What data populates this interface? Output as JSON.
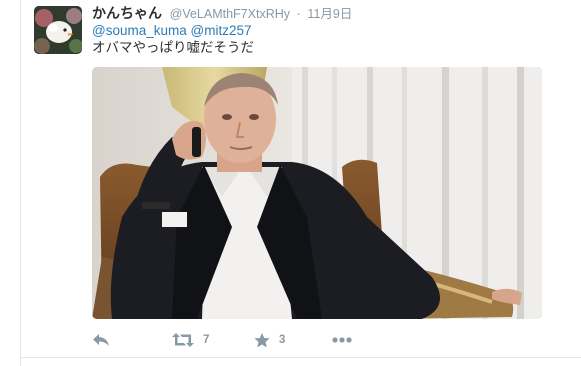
{
  "tweet": {
    "display_name": "かんちゃん",
    "screen_name": "@VeLAMthF7XtxRHy",
    "separator": "·",
    "timestamp": "11月9日",
    "mentions": [
      "@souma_kuma",
      "@mitz257"
    ],
    "text": "オバマやっぱり嘘だそうだ"
  },
  "actions": {
    "reply_icon": "reply-icon",
    "retweet_icon": "retweet-icon",
    "retweet_count": "7",
    "favorite_icon": "star-icon",
    "favorite_count": "3",
    "more_icon": "more-dots-icon"
  },
  "colors": {
    "link": "#2b7bb9",
    "muted": "#8899a6",
    "text": "#292f33",
    "divider": "#e1e8ed"
  }
}
